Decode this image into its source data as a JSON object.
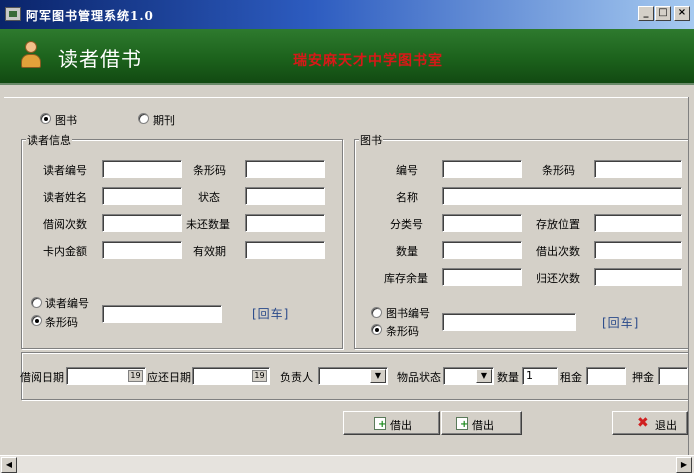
{
  "window": {
    "title": "阿军图书管理系统1.0",
    "min": "_",
    "max": "□",
    "close": "×"
  },
  "banner": {
    "title": "读者借书",
    "school": "瑞安麻天才中学图书室"
  },
  "type_select": {
    "book": "图书",
    "periodical": "期刊",
    "selected": "book"
  },
  "reader": {
    "legend": "读者信息",
    "fields": {
      "reader_no": "读者编号",
      "barcode": "条形码",
      "name": "读者姓名",
      "status": "状态",
      "borrow_count": "借阅次数",
      "unreturned": "未还数量",
      "balance": "卡内金额",
      "valid_until": "有效期"
    },
    "radio_reader_no": "读者编号",
    "radio_barcode": "条形码",
    "enter": "[回车]"
  },
  "book": {
    "legend": "图书",
    "fields": {
      "book_no": "编号",
      "barcode": "条形码",
      "title": "名称",
      "class_no": "分类号",
      "location": "存放位置",
      "quantity": "数量",
      "lent_times": "借出次数",
      "stock": "库存余量",
      "returned_times": "归还次数"
    },
    "radio_book_no": "图书编号",
    "radio_barcode": "条形码",
    "enter": "[回车]"
  },
  "bottom": {
    "borrow_date": "借阅日期",
    "due_date": "应还日期",
    "handler": "负责人",
    "item_status": "物品状态",
    "qty": "数量",
    "qty_value": "1",
    "rent": "租金",
    "deposit": "押金"
  },
  "buttons": {
    "borrow1": "借出",
    "borrow2": "借出",
    "exit": "退出"
  },
  "icons": {
    "window": "app-icon",
    "person": "user-icon",
    "borrow": "add-doc-icon",
    "exit": "close-x-icon"
  }
}
